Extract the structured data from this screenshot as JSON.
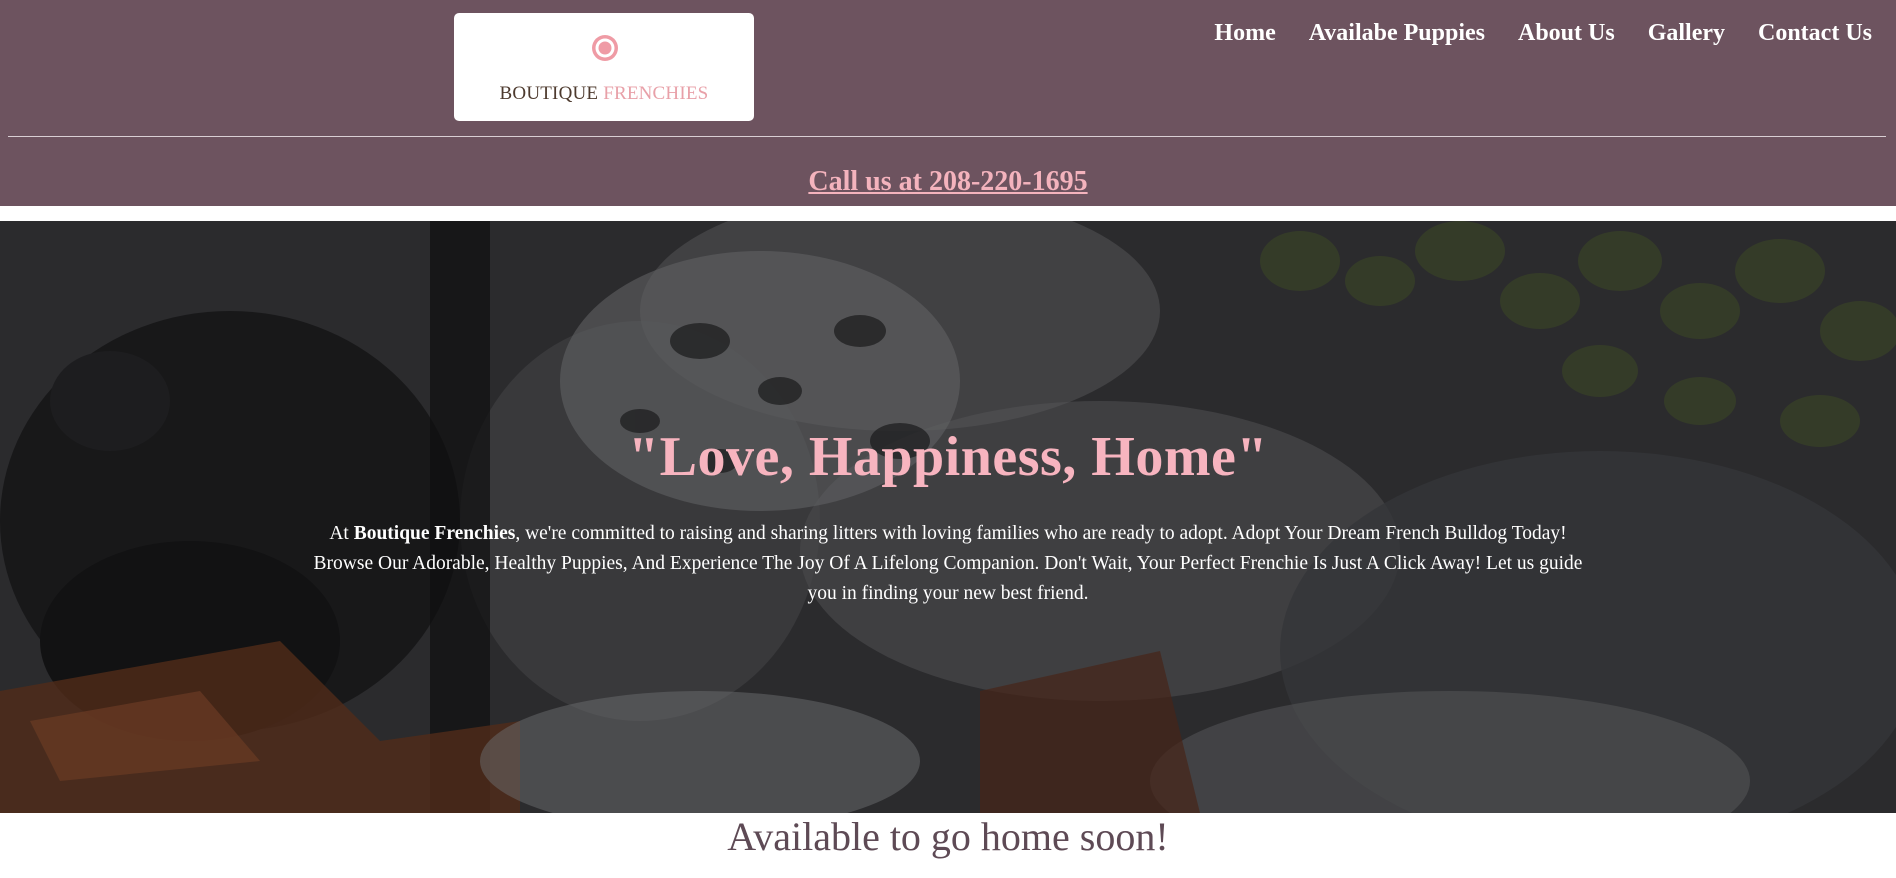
{
  "logo": {
    "word1": "BOUTIQUE",
    "word2": "FRENCHIES",
    "icon": "ring-icon",
    "colors": {
      "dark": "#4d3a2e",
      "pink": "#e8a0a8"
    }
  },
  "nav": {
    "items": [
      {
        "label": "Home"
      },
      {
        "label": "Availabe Puppies"
      },
      {
        "label": "About Us"
      },
      {
        "label": "Gallery"
      },
      {
        "label": "Contact Us"
      }
    ]
  },
  "call": {
    "label": "Call us at 208-220-1695"
  },
  "hero": {
    "title": "\"Love, Happiness, Home\"",
    "text_prefix": "At ",
    "text_bold": "Boutique Frenchies",
    "text_rest": ", we're committed to raising and sharing litters with loving families who are ready to adopt. Adopt Your Dream French Bulldog Today! Browse Our Adorable, Healthy Puppies, And Experience The Joy Of A Lifelong Companion. Don't Wait, Your Perfect Frenchie Is Just A Click Away! Let us guide you in finding your new best friend."
  },
  "section": {
    "title": "Available to go home soon!"
  },
  "colors": {
    "header_bg": "#6d535f",
    "accent_pink": "#f4b3bd",
    "hero_title": "#f7b4bf",
    "section_title": "#5e4a55"
  }
}
